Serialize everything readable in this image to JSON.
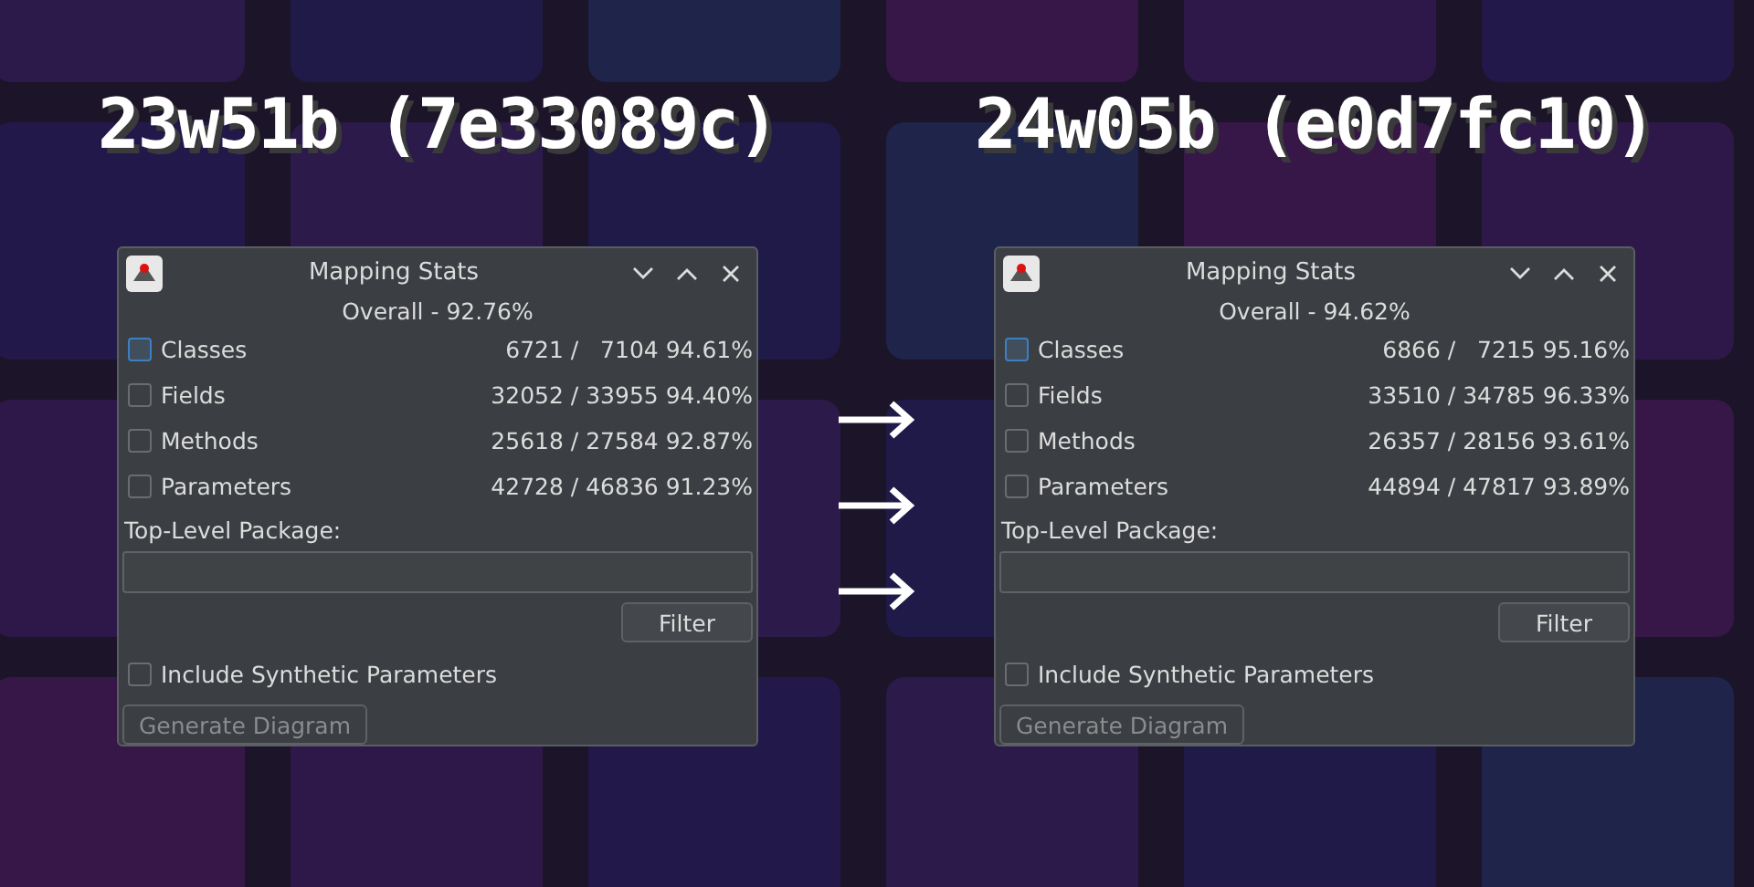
{
  "panels": [
    {
      "version": "23w51b (7e33089c)",
      "window": {
        "title": "Mapping Stats",
        "overall": "Overall - 92.76%",
        "stats": [
          {
            "label": "Classes",
            "checked": false,
            "focused": true,
            "counts": "6721 /   7104 94.61%"
          },
          {
            "label": "Fields",
            "checked": false,
            "focused": false,
            "counts": "32052 / 33955 94.40%"
          },
          {
            "label": "Methods",
            "checked": false,
            "focused": false,
            "counts": "25618 / 27584 92.87%"
          },
          {
            "label": "Parameters",
            "checked": false,
            "focused": false,
            "counts": "42728 / 46836 91.23%"
          }
        ],
        "package_label": "Top-Level Package:",
        "filter_button": "Filter",
        "synthetic": {
          "label": "Include Synthetic Parameters",
          "checked": false
        },
        "generate_button": {
          "label": "Generate Diagram",
          "disabled": true
        }
      }
    },
    {
      "version": "24w05b (e0d7fc10)",
      "window": {
        "title": "Mapping Stats",
        "overall": "Overall - 94.62%",
        "stats": [
          {
            "label": "Classes",
            "checked": false,
            "focused": true,
            "counts": "6866 /   7215 95.16%"
          },
          {
            "label": "Fields",
            "checked": false,
            "focused": false,
            "counts": "33510 / 34785 96.33%"
          },
          {
            "label": "Methods",
            "checked": false,
            "focused": false,
            "counts": "26357 / 28156 93.61%"
          },
          {
            "label": "Parameters",
            "checked": false,
            "focused": false,
            "counts": "44894 / 47817 93.89%"
          }
        ],
        "package_label": "Top-Level Package:",
        "filter_button": "Filter",
        "synthetic": {
          "label": "Include Synthetic Parameters",
          "checked": false
        },
        "generate_button": {
          "label": "Generate Diagram",
          "disabled": true
        }
      }
    }
  ]
}
